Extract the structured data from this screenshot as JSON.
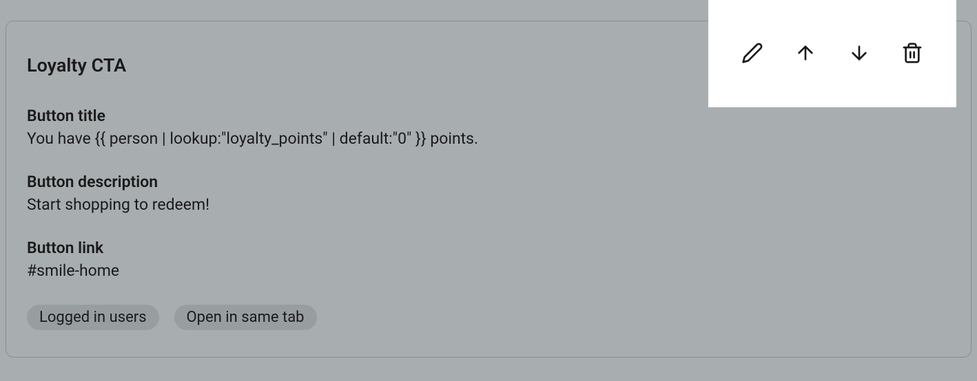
{
  "card": {
    "title": "Loyalty CTA",
    "fields": {
      "button_title": {
        "label": "Button title",
        "value": "You have {{ person | lookup:\"loyalty_points\" | default:\"0\" }} points."
      },
      "button_description": {
        "label": "Button description",
        "value": "Start shopping to redeem!"
      },
      "button_link": {
        "label": "Button link",
        "value": "#smile-home"
      }
    },
    "tags": [
      "Logged in users",
      "Open in same tab"
    ]
  },
  "toolbar": {
    "edit": "edit",
    "move_up": "move up",
    "move_down": "move down",
    "delete": "delete"
  }
}
